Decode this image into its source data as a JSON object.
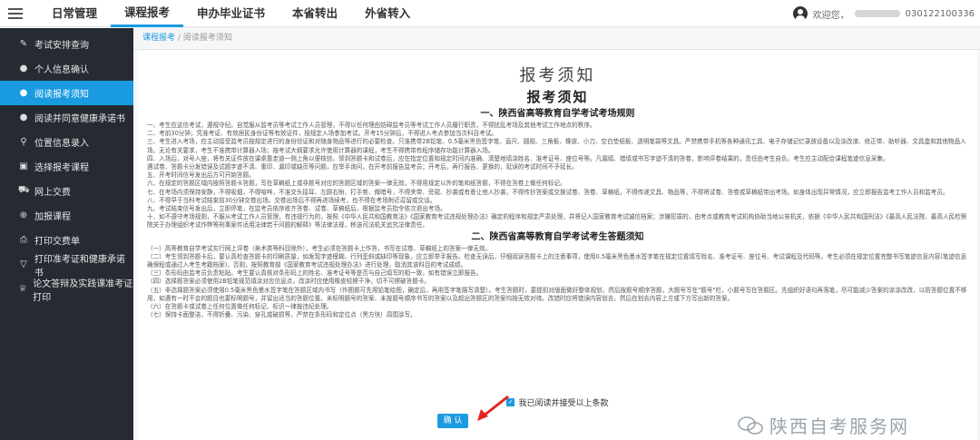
{
  "header": {
    "nav": [
      {
        "label": "日常管理",
        "active": false
      },
      {
        "label": "课程报考",
        "active": true
      },
      {
        "label": "申办毕业证书",
        "active": false
      },
      {
        "label": "本省转出",
        "active": false
      },
      {
        "label": "外省转入",
        "active": false
      }
    ],
    "welcome": "欢迎您，",
    "user_id_suffix": "030122100336"
  },
  "sidebar": {
    "items": [
      {
        "icon": "pen-icon",
        "glyph": "✎",
        "label": "考试安排查询",
        "active": false
      },
      {
        "icon": "chat-icon",
        "glyph": "●",
        "label": "个人信息确认",
        "active": false
      },
      {
        "icon": "chat-icon",
        "glyph": "●",
        "label": "阅读报考须知",
        "active": true
      },
      {
        "icon": "chat-icon",
        "glyph": "●",
        "label": "阅读并同意健康承诺书",
        "active": false
      },
      {
        "icon": "location-icon",
        "glyph": "⚲",
        "label": "位置信息录入",
        "active": false
      },
      {
        "icon": "list-icon",
        "glyph": "▣",
        "label": "选择报考课程",
        "active": false
      },
      {
        "icon": "cart-icon",
        "glyph": "⛟",
        "label": "网上交费",
        "active": false
      },
      {
        "icon": "plus-circle-icon",
        "glyph": "⊕",
        "label": "加报课程",
        "active": false
      },
      {
        "icon": "printer-icon",
        "glyph": "⎙",
        "label": "打印交费单",
        "active": false
      },
      {
        "icon": "filter-icon",
        "glyph": "▽",
        "label": "打印准考证和健康承诺书",
        "active": false
      },
      {
        "icon": "trophy-icon",
        "glyph": "♕",
        "label": "论文答辩及实践课准考证打印",
        "active": false
      }
    ]
  },
  "breadcrumb": {
    "root": "课程报考",
    "separator": "/",
    "current": "阅读报考须知"
  },
  "page_title": "报考须知",
  "doc": {
    "heading": "报考须知",
    "section1_title": "一、陕西省高等教育自学考试考场规则",
    "section1": [
      "一、考生应这信考试，遵规守纪。自觉服从监考员等考试工作人员管理，不得以任何理由妨碍监考员等考试工作人员履行职责，不得扰乱考场及其他考试工作地点的秩序。",
      "二、考前30分钟，凭准考证、有效居民身份证等有效证件，按规定入场参加考试。开考15分钟后，不得进入考点参加当次科目考试。",
      "三、考生进入考场，应主动接受监考员按规定进行的身份验证和对随身物品等进行的必要检查。只准携带2B铅笔、0.5毫米黑色签字笔、直尺、圆规、三角板、橡皮、小刀、空白垫纸板、透明笔袋等文具。严禁携带手机等各种通讯工具、电子存储记忆录放设备以及涂改液、修正带、助听器、文具盒和其他物品入场。无论有关要求，考生不准携带计算器入场；按考试大纲要求允许使用计算器的课程，考生不得携带有程序储存功能计算器入场。",
      "四、入场后，对号入座，将有关证件放在课桌靠走道一侧上角以便核验。领到答题卡和试卷后，应在指定位置和规定时间内准确、清楚地填涂姓名、准考证号、座位号等。凡漏填、错填或书写字迹不清的答卷，影响评卷结果的，责任由考生自负。考生应主动配合课程笔迹信息采集。",
      "遇试卷、答题卡分发错误及试题字迹不清、重印、漏印或缺页等问题，应举手询问，在开考前报告监考员；开考后，再行报告、更换的，延误的考试时间不予延长。",
      "五、开考时间信号发出后方可开始答题。",
      "六、在规定的答题区域内按照答题卡答题，写在草稿纸上或非题号对应的答题区域的答案一律无效。不得用规定以外的笔和纸答题，不得在答卷上做任何标记。",
      "七、在考场内须保持安静，不得吸烟，不得喧哗，不准交头接耳、左顾右盼、打手势、做暗号，不得夹带、旁窥、抄袭或有意让他人抄袭，不得传抄答案或交换试卷、答卷、草稿纸，不得传递文具、物品等，不得将试卷、答卷或草稿纸带出考场。如身体出现异常情况，应立即报告监考工作人员和监考员。",
      "八、不得早于当科考试结束前30分钟交卷出场。交卷出场后不得再进场续考，也不得在考场附近逗留或交谈。",
      "九、考试结束信号发出后，立即停笔，在监考员依序收齐答卷、试卷、草稿纸后，根据监考员指令依次退出考场。",
      "十、如不遵守考场规则，不服从考试工作人员管理，有违规行为的，按照《中华人民共和国教育法》《国家教育考试违规处理办法》确定的程序和规定严肃处理，并将记入国家教育考试诚信档案；涉嫌犯罪的，由考点或教育考试机构协助当地公安机关，依据《中华人民共和国刑法》《最高人民法院、最高人民检察院关于办理组织考试作弊等刑事案件适用法律若干问题的解释》等法律法规，移送司法机关追究法律责任。"
    ],
    "section2_title": "二、陕西省高等教育自学考试考生答题须知",
    "section2": [
      "（一）高等教育自学考试实行网上评卷（美术类等科目除外），考生必须在答题卡上作答，书写在试卷、草稿纸上的答案一律无效。",
      "（二）考生领到答题卡后，要认真检查答题卡的印刷质量，如发现字迹模糊、行列歪斜或缺印等现象，应立即举手报告。检查无误后，仔细阅读答题卡上的注意事项，使用0.5毫米黑色墨水签字笔在规定位置填写姓名、准考证号、座位号、考试课程及代码等。考生必须在规定位置完整书写笔迹信息内容(笔迹信息确保程或通过入考生考籍档案)，否则，按照教育部《国家教育考试违规处理办法》进行处理，取消其该科目的考试成绩。",
      "（三）条形码由监考员负责粘贴。考生要认真核对条形码上的姓名、准考证号等是否与自己填写的相一致，如有错误立即报告。",
      "（四）选择题答案必须使用2B铅笔规范填涂对应信息点，改涂时应使用橡皮轻擦干净，切不可擦破答题卡。",
      "（五）非选择题答案必须使用0.5毫米黑色墨水签字笔在答题区域内书写（作图题可先用铅笔绘图，确定后，再用签字笔描写清楚）。考生答题时，要提前对版面做好整体规划，然后按题号顺序答题，大题号写在\"题号\"栏，小题号写在答题区。先组织好语句再落笔，尽可能减少答案的涂涂改改，以防答题位置不够用，如遇有一时不会的题目也要标明题号，并留出适当的答题位置。未标明题号的答案、未按题号顺序书写的答案以及超出答题区的答案均按无效对待。改错时应将错误内容划去，然后在划去内容上方或下方写出新的答案。",
      "（六）在答题卡或试卷上任何位置做任何标记、标识一律按违纪处理。",
      "（七）保持卡面整洁，不得折叠、污染、穿孔或破损等，严禁在条形码和定位点（黑方块）周围涂写。"
    ]
  },
  "agree_label": "我已阅读并接受以上条款",
  "agree_checked": true,
  "confirm_label": "确 认",
  "watermark": "陕西自考服务网",
  "colors": {
    "accent": "#1a9ae0",
    "sidebar_bg": "#262b33",
    "arrow": "#e52421"
  }
}
